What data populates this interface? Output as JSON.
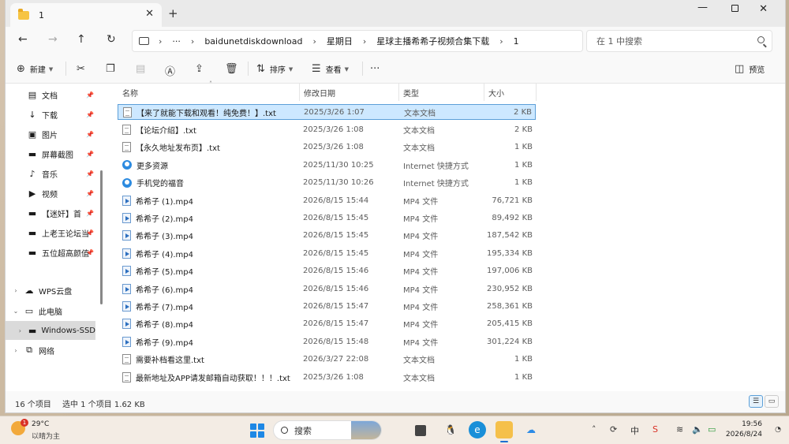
{
  "tab": {
    "title": "1"
  },
  "breadcrumb": [
    "baidunetdiskdownload",
    "星期日",
    "星球主播希希子视频合集下载",
    "1"
  ],
  "search": {
    "placeholder": "在 1 中搜索"
  },
  "toolbar": {
    "new_label": "新建",
    "sort_label": "排序",
    "view_label": "查看",
    "preview_label": "预览"
  },
  "sidebar": {
    "quick": [
      {
        "label": "文档",
        "icon": "document-icon"
      },
      {
        "label": "下载",
        "icon": "download-icon"
      },
      {
        "label": "图片",
        "icon": "picture-icon"
      },
      {
        "label": "屏幕截图",
        "icon": "folder-icon"
      },
      {
        "label": "音乐",
        "icon": "music-icon"
      },
      {
        "label": "视频",
        "icon": "video-icon"
      },
      {
        "label": "【迷奸】首",
        "icon": "folder-icon"
      },
      {
        "label": "上老王论坛当",
        "icon": "folder-icon"
      },
      {
        "label": "五位超高颜值",
        "icon": "folder-icon"
      }
    ],
    "tree": [
      {
        "label": "WPS云盘",
        "icon": "cloud-icon"
      },
      {
        "label": "此电脑",
        "icon": "computer-icon"
      },
      {
        "label": "Windows-SSD",
        "icon": "drive-icon"
      },
      {
        "label": "网络",
        "icon": "network-icon"
      }
    ]
  },
  "columns": {
    "name": "名称",
    "date": "修改日期",
    "type": "类型",
    "size": "大小"
  },
  "files": [
    {
      "name": "【来了就能下载和观看！纯免费！】.txt",
      "date": "2025/3/26 1:07",
      "type": "文本文档",
      "size": "2 KB",
      "kind": "txt"
    },
    {
      "name": "【论坛介绍】.txt",
      "date": "2025/3/26 1:08",
      "type": "文本文档",
      "size": "2 KB",
      "kind": "txt"
    },
    {
      "name": "【永久地址发布页】.txt",
      "date": "2025/3/26 1:08",
      "type": "文本文档",
      "size": "1 KB",
      "kind": "txt"
    },
    {
      "name": "更多资源",
      "date": "2025/11/30 10:25",
      "type": "Internet 快捷方式",
      "size": "1 KB",
      "kind": "url"
    },
    {
      "name": "手机党的福音",
      "date": "2025/11/30 10:26",
      "type": "Internet 快捷方式",
      "size": "1 KB",
      "kind": "url"
    },
    {
      "name": "希希子 (1).mp4",
      "date": "2026/8/15 15:44",
      "type": "MP4 文件",
      "size": "76,721 KB",
      "kind": "mp4"
    },
    {
      "name": "希希子 (2).mp4",
      "date": "2026/8/15 15:45",
      "type": "MP4 文件",
      "size": "89,492 KB",
      "kind": "mp4"
    },
    {
      "name": "希希子 (3).mp4",
      "date": "2026/8/15 15:45",
      "type": "MP4 文件",
      "size": "187,542 KB",
      "kind": "mp4"
    },
    {
      "name": "希希子 (4).mp4",
      "date": "2026/8/15 15:45",
      "type": "MP4 文件",
      "size": "195,334 KB",
      "kind": "mp4"
    },
    {
      "name": "希希子 (5).mp4",
      "date": "2026/8/15 15:46",
      "type": "MP4 文件",
      "size": "197,006 KB",
      "kind": "mp4"
    },
    {
      "name": "希希子 (6).mp4",
      "date": "2026/8/15 15:46",
      "type": "MP4 文件",
      "size": "230,952 KB",
      "kind": "mp4"
    },
    {
      "name": "希希子 (7).mp4",
      "date": "2026/8/15 15:47",
      "type": "MP4 文件",
      "size": "258,361 KB",
      "kind": "mp4"
    },
    {
      "name": "希希子 (8).mp4",
      "date": "2026/8/15 15:47",
      "type": "MP4 文件",
      "size": "205,415 KB",
      "kind": "mp4"
    },
    {
      "name": "希希子 (9).mp4",
      "date": "2026/8/15 15:48",
      "type": "MP4 文件",
      "size": "301,224 KB",
      "kind": "mp4"
    },
    {
      "name": "需要补档看这里.txt",
      "date": "2026/3/27 22:08",
      "type": "文本文档",
      "size": "1 KB",
      "kind": "txt"
    },
    {
      "name": "最新地址及APP请发邮箱自动获取！！！.txt",
      "date": "2025/3/26 1:08",
      "type": "文本文档",
      "size": "1 KB",
      "kind": "txt"
    }
  ],
  "status": {
    "count": "16 个项目",
    "selection": "选中 1 个项目  1.62 KB"
  },
  "taskbar": {
    "weather_temp": "29°C",
    "weather_desc": "以晴为主",
    "weather_badge": "1",
    "search_label": "搜索",
    "time": "19:56",
    "date": "2026/8/24",
    "ime": "中"
  }
}
